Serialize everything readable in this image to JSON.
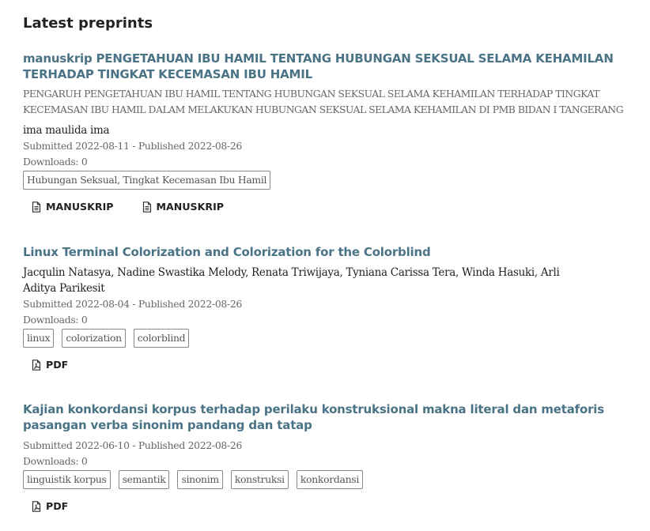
{
  "section_title": "Latest preprints",
  "items": [
    {
      "title": "manuskrip PENGETAHUAN IBU HAMIL TENTANG HUBUNGAN SEKSUAL SELAMA KEHAMILAN TERHADAP TINGKAT KECEMASAN IBU HAMIL",
      "abstract": "PENGARUH PENGETAHUAN IBU HAMIL TENTANG HUBUNGAN SEKSUAL SELAMA KEHAMILAN TERHADAP TINGKAT KECEMASAN IBU HAMIL DALAM MELAKUKAN HUBUNGAN SEKSUAL SELAMA KEHAMILAN DI PMB BIDAN I TANGERANG",
      "authors": "ima maulida ima",
      "dates": "Submitted 2022-08-11 - Published 2022-08-26",
      "downloads": "Downloads: 0",
      "tags": [
        "Hubungan Seksual, Tingkat Kecemasan Ibu Hamil"
      ],
      "galleys": [
        {
          "label": "MANUSKRIP",
          "icon": "document-icon"
        },
        {
          "label": "MANUSKRIP",
          "icon": "document-icon"
        }
      ]
    },
    {
      "title": "Linux Terminal Colorization and Colorization for the Colorblind",
      "authors_line1": "Jacqulin Natasya, Nadine Swastika Melody, Renata Triwijaya, Tyniana Carissa Tera, Winda Hasuki, Arli",
      "authors_line2": "Aditya Parikesit",
      "dates": "Submitted 2022-08-04 - Published 2022-08-26",
      "downloads": "Downloads: 0",
      "tags": [
        "linux",
        "colorization",
        "colorblind"
      ],
      "galleys": [
        {
          "label": "PDF",
          "icon": "pdf-icon"
        }
      ]
    },
    {
      "title": "Kajian konkordansi korpus terhadap perilaku konstruksional makna literal dan metaforis pasangan verba sinonim pandang dan tatap",
      "dates": "Submitted 2022-06-10 - Published 2022-08-26",
      "downloads": "Downloads: 0",
      "tags": [
        "linguistik korpus",
        "semantik",
        "sinonim",
        "konstruksi",
        "konkordansi"
      ],
      "galleys": [
        {
          "label": "PDF",
          "icon": "pdf-icon"
        }
      ]
    }
  ],
  "colors": {
    "title_link": "#4a7386",
    "meta_text": "#666666",
    "body_text": "#222222",
    "tag_border": "#888888"
  }
}
